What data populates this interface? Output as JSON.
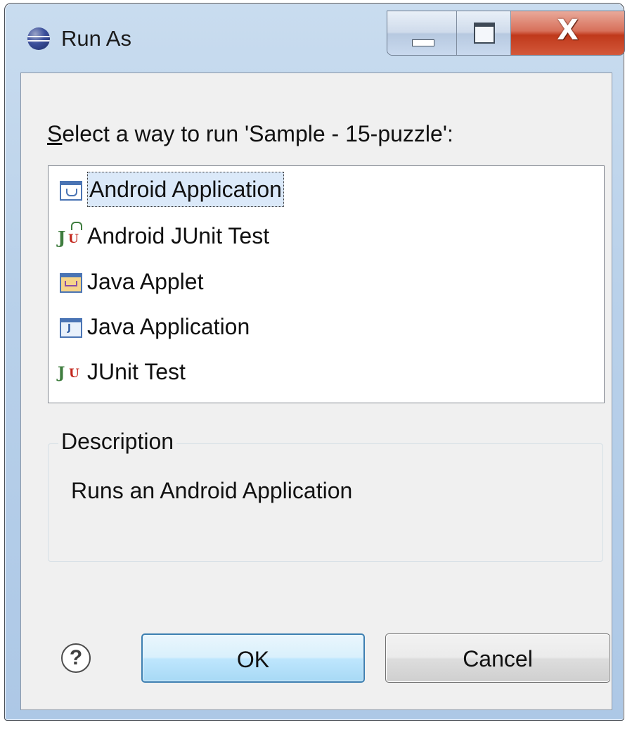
{
  "window": {
    "title": "Run As",
    "icon": "eclipse-icon",
    "close_glyph": "X"
  },
  "prompt": {
    "mnemonic": "S",
    "rest": "elect a way to run 'Sample - 15-puzzle':"
  },
  "launch_options": [
    {
      "label": "Android Application",
      "icon": "android-application-icon",
      "selected": true
    },
    {
      "label": "Android JUnit Test",
      "icon": "android-junit-icon",
      "selected": false
    },
    {
      "label": "Java Applet",
      "icon": "java-applet-icon",
      "selected": false
    },
    {
      "label": "Java Application",
      "icon": "java-application-icon",
      "selected": false
    },
    {
      "label": "JUnit Test",
      "icon": "junit-icon",
      "selected": false
    }
  ],
  "description": {
    "legend": "Description",
    "text": "Runs an Android Application"
  },
  "buttons": {
    "help_glyph": "?",
    "ok": "OK",
    "cancel": "Cancel"
  },
  "colors": {
    "selection": "#dbe9f9",
    "close_button": "#c0391b",
    "dialog_background": "#f0f0f0",
    "default_button_border": "#3c7fb1"
  }
}
